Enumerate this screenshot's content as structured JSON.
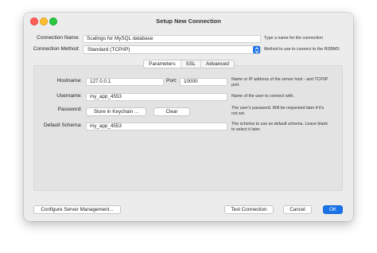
{
  "window": {
    "title": "Setup New Connection"
  },
  "connection_name": {
    "label": "Connection Name:",
    "value": "Scalingo for MySQL database",
    "hint": "Type a name for the connection"
  },
  "connection_method": {
    "label": "Connection Method:",
    "value": "Standard (TCP/IP)",
    "hint": "Method to use to connect to the RDBMS"
  },
  "tabs": [
    {
      "label": "Parameters",
      "active": true
    },
    {
      "label": "SSL",
      "active": false
    },
    {
      "label": "Advanced",
      "active": false
    }
  ],
  "hostname": {
    "label": "Hostname:",
    "value": "127.0.0.1",
    "hint_line1": "Name or IP address of the server host - and TCP/IP",
    "hint_line2": "port."
  },
  "port": {
    "label": "Port:",
    "value": "10000"
  },
  "username": {
    "label": "Username:",
    "value": "my_app_4553",
    "hint": "Name of the user to connect with."
  },
  "password": {
    "label": "Password:",
    "store_label": "Store in Keychain ...",
    "clear_label": "Clear",
    "hint_line1": "The user's password. Will be requested later if it's",
    "hint_line2": "not set."
  },
  "default_schema": {
    "label": "Default Schema:",
    "value": "my_app_4553",
    "hint_line1": "The schema to use as default schema. Leave blank",
    "hint_line2": "to select it later."
  },
  "footer": {
    "configure_label": "Configure Server Management...",
    "test_label": "Test Connection",
    "cancel_label": "Cancel",
    "ok_label": "OK"
  },
  "colors": {
    "accent": "#1a73e8",
    "window_bg": "#ececec",
    "panel_bg": "#e3e3e3"
  }
}
